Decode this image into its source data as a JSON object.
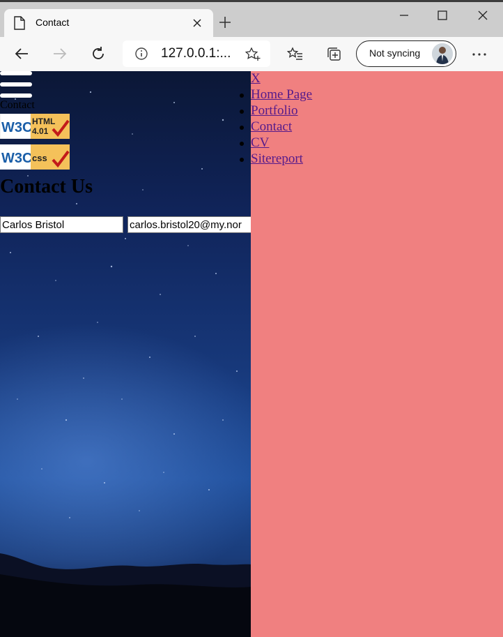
{
  "browser": {
    "tab_title": "Contact",
    "address": "127.0.0.1:...",
    "sync_label": "Not syncing"
  },
  "page": {
    "page_label": "Contact",
    "badges": [
      {
        "alt": "W3C HTML 4.01"
      },
      {
        "alt": "W3C CSS"
      }
    ],
    "heading": "Contact Us",
    "form": {
      "name_value": "Carlos Bristol",
      "email_value": "carlos.bristol20@my.nor"
    }
  },
  "menu": {
    "close_label": "X",
    "items": [
      "Home Page",
      "Portfolio",
      "Contact",
      "CV",
      "Sitereport"
    ]
  },
  "colors": {
    "menu_bg": "#f08080",
    "link": "#551a8b"
  }
}
